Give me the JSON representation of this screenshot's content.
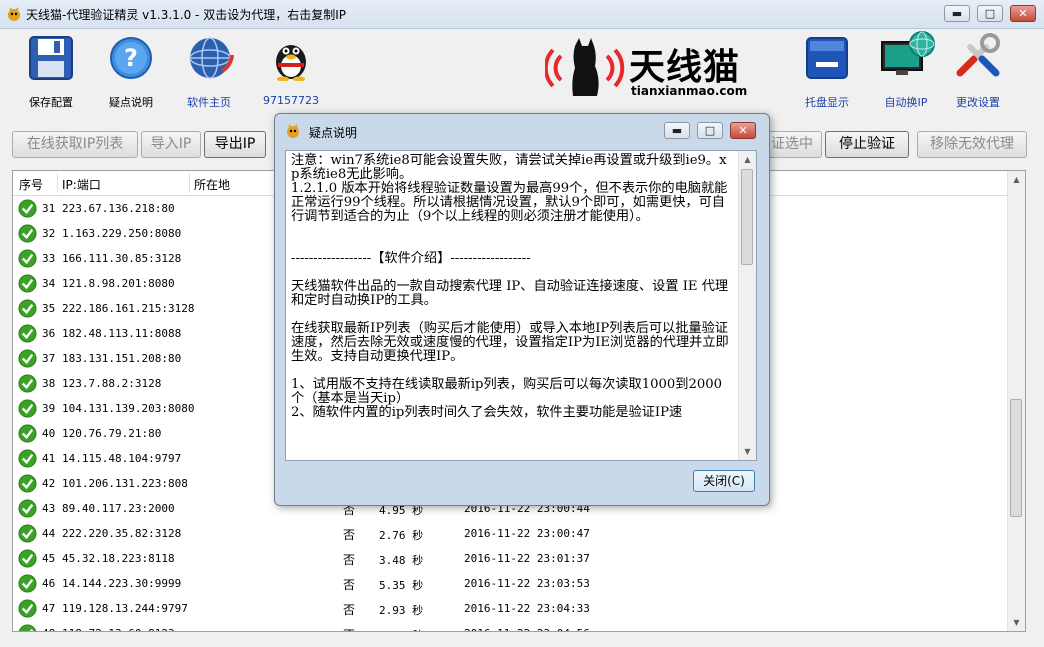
{
  "window": {
    "title": "天线猫-代理验证精灵 v1.3.1.0 - 双击设为代理，右击复制IP",
    "minimize": "▬",
    "maximize": "□",
    "close": "✕"
  },
  "toolbar": {
    "save": "保存配置",
    "help": "疑点说明",
    "home": "软件主页",
    "qq": "97157723",
    "tray": "托盘显示",
    "auto_ip": "自动换IP",
    "settings": "更改设置"
  },
  "brand": {
    "name": "天线猫",
    "url": "tianxianmao.com"
  },
  "buttons": {
    "online_get": "在线获取IP列表",
    "import": "导入IP",
    "export": "导出IP",
    "verify_selected": "证选中",
    "stop_verify": "停止验证",
    "remove_invalid": "移除无效代理"
  },
  "table": {
    "headers": {
      "index": "序号",
      "ip_port": "IP:端口",
      "location": "所在地"
    },
    "rows": [
      {
        "num": "31",
        "ip": "223.67.136.218:80",
        "anon": "",
        "speed": "",
        "time": ""
      },
      {
        "num": "32",
        "ip": "1.163.229.250:8080",
        "anon": "",
        "speed": "",
        "time": ""
      },
      {
        "num": "33",
        "ip": "166.111.30.85:3128",
        "anon": "",
        "speed": "",
        "time": ""
      },
      {
        "num": "34",
        "ip": "121.8.98.201:8080",
        "anon": "",
        "speed": "",
        "time": ""
      },
      {
        "num": "35",
        "ip": "222.186.161.215:3128",
        "anon": "",
        "speed": "",
        "time": ""
      },
      {
        "num": "36",
        "ip": "182.48.113.11:8088",
        "anon": "",
        "speed": "",
        "time": ""
      },
      {
        "num": "37",
        "ip": "183.131.151.208:80",
        "anon": "",
        "speed": "",
        "time": ""
      },
      {
        "num": "38",
        "ip": "123.7.88.2:3128",
        "anon": "",
        "speed": "",
        "time": ""
      },
      {
        "num": "39",
        "ip": "104.131.139.203:8080",
        "anon": "",
        "speed": "",
        "time": ""
      },
      {
        "num": "40",
        "ip": "120.76.79.21:80",
        "anon": "",
        "speed": "",
        "time": ""
      },
      {
        "num": "41",
        "ip": "14.115.48.104:9797",
        "anon": "",
        "speed": "",
        "time": ""
      },
      {
        "num": "42",
        "ip": "101.206.131.223:808",
        "anon": "",
        "speed": "",
        "time": ""
      },
      {
        "num": "43",
        "ip": "89.40.117.23:2000",
        "anon": "否",
        "speed": "4.95 秒",
        "time": "2016-11-22 23:00:44"
      },
      {
        "num": "44",
        "ip": "222.220.35.82:3128",
        "anon": "否",
        "speed": "2.76 秒",
        "time": "2016-11-22 23:00:47"
      },
      {
        "num": "45",
        "ip": "45.32.18.223:8118",
        "anon": "否",
        "speed": "3.48 秒",
        "time": "2016-11-22 23:01:37"
      },
      {
        "num": "46",
        "ip": "14.144.223.30:9999",
        "anon": "否",
        "speed": "5.35 秒",
        "time": "2016-11-22 23:03:53"
      },
      {
        "num": "47",
        "ip": "119.128.13.244:9797",
        "anon": "否",
        "speed": "2.93 秒",
        "time": "2016-11-22 23:04:33"
      },
      {
        "num": "48",
        "ip": "118.72.13.60:8123",
        "anon": "否",
        "speed": "3.80 秒",
        "time": "2016-11-22 23:04:56"
      }
    ]
  },
  "dialog": {
    "title": "疑点说明",
    "content": "注意：win7系统ie8可能会设置失败，请尝试关掉ie再设置或升级到ie9。xp系统ie8无此影响。\n1.2.1.0 版本开始将线程验证数量设置为最高99个，但不表示你的电脑就能正常运行99个线程。所以请根据情况设置，默认9个即可，如需更快，可自行调节到适合的为止（9个以上线程的则必须注册才能使用）。\n\n\n------------------【软件介绍】------------------\n\n天线猫软件出品的一款自动搜索代理 IP、自动验证连接速度、设置 IE 代理和定时自动换IP的工具。\n\n在线获取最新IP列表（购买后才能使用）或导入本地IP列表后可以批量验证速度，然后去除无效或速度慢的代理，设置指定IP为IE浏览器的代理并立即生效。支持自动更换代理IP。\n\n1、试用版不支持在线读取最新ip列表，购买后可以每次读取1000到2000个（基本是当天ip）\n2、随软件内置的ip列表时间久了会失效，软件主要功能是验证IP速",
    "close_button": "关闭(C)"
  },
  "colors": {
    "check_green": "#3aa224",
    "brand_red": "#e8282b",
    "link_blue": "#1c3fa8"
  }
}
